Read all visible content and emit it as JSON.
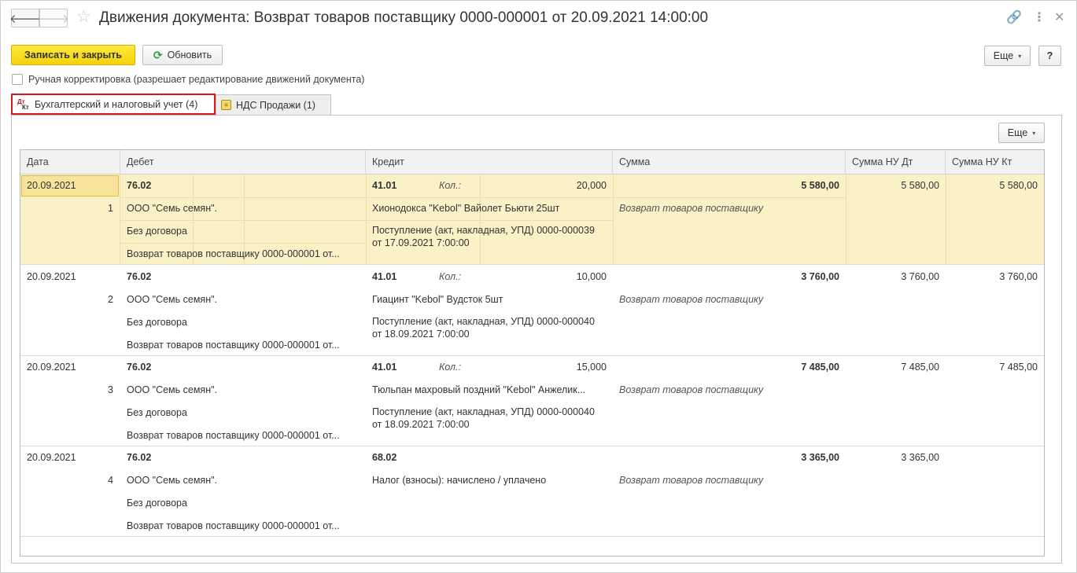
{
  "window": {
    "title": "Движения документа: Возврат товаров поставщику 0000-000001 от 20.09.2021 14:00:00",
    "back_icon": "🡐",
    "forward_icon": "🡒",
    "star_icon": "☆",
    "link_icon": "🔗",
    "more_icon": "⋮",
    "close_icon": "✕"
  },
  "toolbar": {
    "save_close_label": "Записать и закрыть",
    "refresh_label": "Обновить",
    "refresh_icon": "⟳",
    "more_label": "Еще",
    "caret": "▾",
    "help_label": "?"
  },
  "manual_edit": {
    "label": "Ручная корректировка (разрешает редактирование движений документа)"
  },
  "tabs": [
    {
      "label": "Бухгалтерский и налоговый учет (4)",
      "icon_top": "Дт",
      "icon_bottom": "Кт"
    },
    {
      "label": "НДС Продажи (1)",
      "icon_text": "≡"
    }
  ],
  "panel": {
    "more_label": "Еще"
  },
  "columns": [
    "Дата",
    "Дебет",
    "Кредит",
    "Сумма",
    "Сумма НУ Дт",
    "Сумма НУ Кт"
  ],
  "qty_label": "Кол.:",
  "records": [
    {
      "date": "20.09.2021",
      "num": "1",
      "debit_account": "76.02",
      "debit_sub1": "ООО \"Семь семян\".",
      "debit_sub2": "Без договора",
      "debit_sub3": "Возврат товаров поставщику 0000-000001 от...",
      "credit_account": "41.01",
      "qty": "20,000",
      "credit_sub1": "Хионодокса \"Kebol\" Вайолет Бьюти 25шт",
      "credit_sub2": "Поступление (акт, накладная, УПД) 0000-000039 от 17.09.2021 7:00:00",
      "amount": "5 580,00",
      "content": "Возврат товаров поставщику",
      "nu_dt": "5 580,00",
      "nu_kt": "5 580,00"
    },
    {
      "date": "20.09.2021",
      "num": "2",
      "debit_account": "76.02",
      "debit_sub1": "ООО \"Семь семян\".",
      "debit_sub2": "Без договора",
      "debit_sub3": "Возврат товаров поставщику 0000-000001 от...",
      "credit_account": "41.01",
      "qty": "10,000",
      "credit_sub1": "Гиацинт \"Kebol\" Вудсток 5шт",
      "credit_sub2": "Поступление (акт, накладная, УПД) 0000-000040 от 18.09.2021 7:00:00",
      "amount": "3 760,00",
      "content": "Возврат товаров поставщику",
      "nu_dt": "3 760,00",
      "nu_kt": "3 760,00"
    },
    {
      "date": "20.09.2021",
      "num": "3",
      "debit_account": "76.02",
      "debit_sub1": "ООО \"Семь семян\".",
      "debit_sub2": "Без договора",
      "debit_sub3": "Возврат товаров поставщику 0000-000001 от...",
      "credit_account": "41.01",
      "qty": "15,000",
      "credit_sub1": "Тюльпан махровый поздний \"Kebol\" Анжелик...",
      "credit_sub2": "Поступление (акт, накладная, УПД) 0000-000040 от 18.09.2021 7:00:00",
      "amount": "7 485,00",
      "content": "Возврат товаров поставщику",
      "nu_dt": "7 485,00",
      "nu_kt": "7 485,00"
    },
    {
      "date": "20.09.2021",
      "num": "4",
      "debit_account": "76.02",
      "debit_sub1": "ООО \"Семь семян\".",
      "debit_sub2": "Без договора",
      "debit_sub3": "Возврат товаров поставщику 0000-000001 от...",
      "credit_account": "68.02",
      "qty": "",
      "credit_sub1": "Налог (взносы): начислено / уплачено",
      "credit_sub2": "",
      "amount": "3 365,00",
      "content": "Возврат товаров поставщику",
      "nu_dt": "3 365,00",
      "nu_kt": ""
    }
  ]
}
